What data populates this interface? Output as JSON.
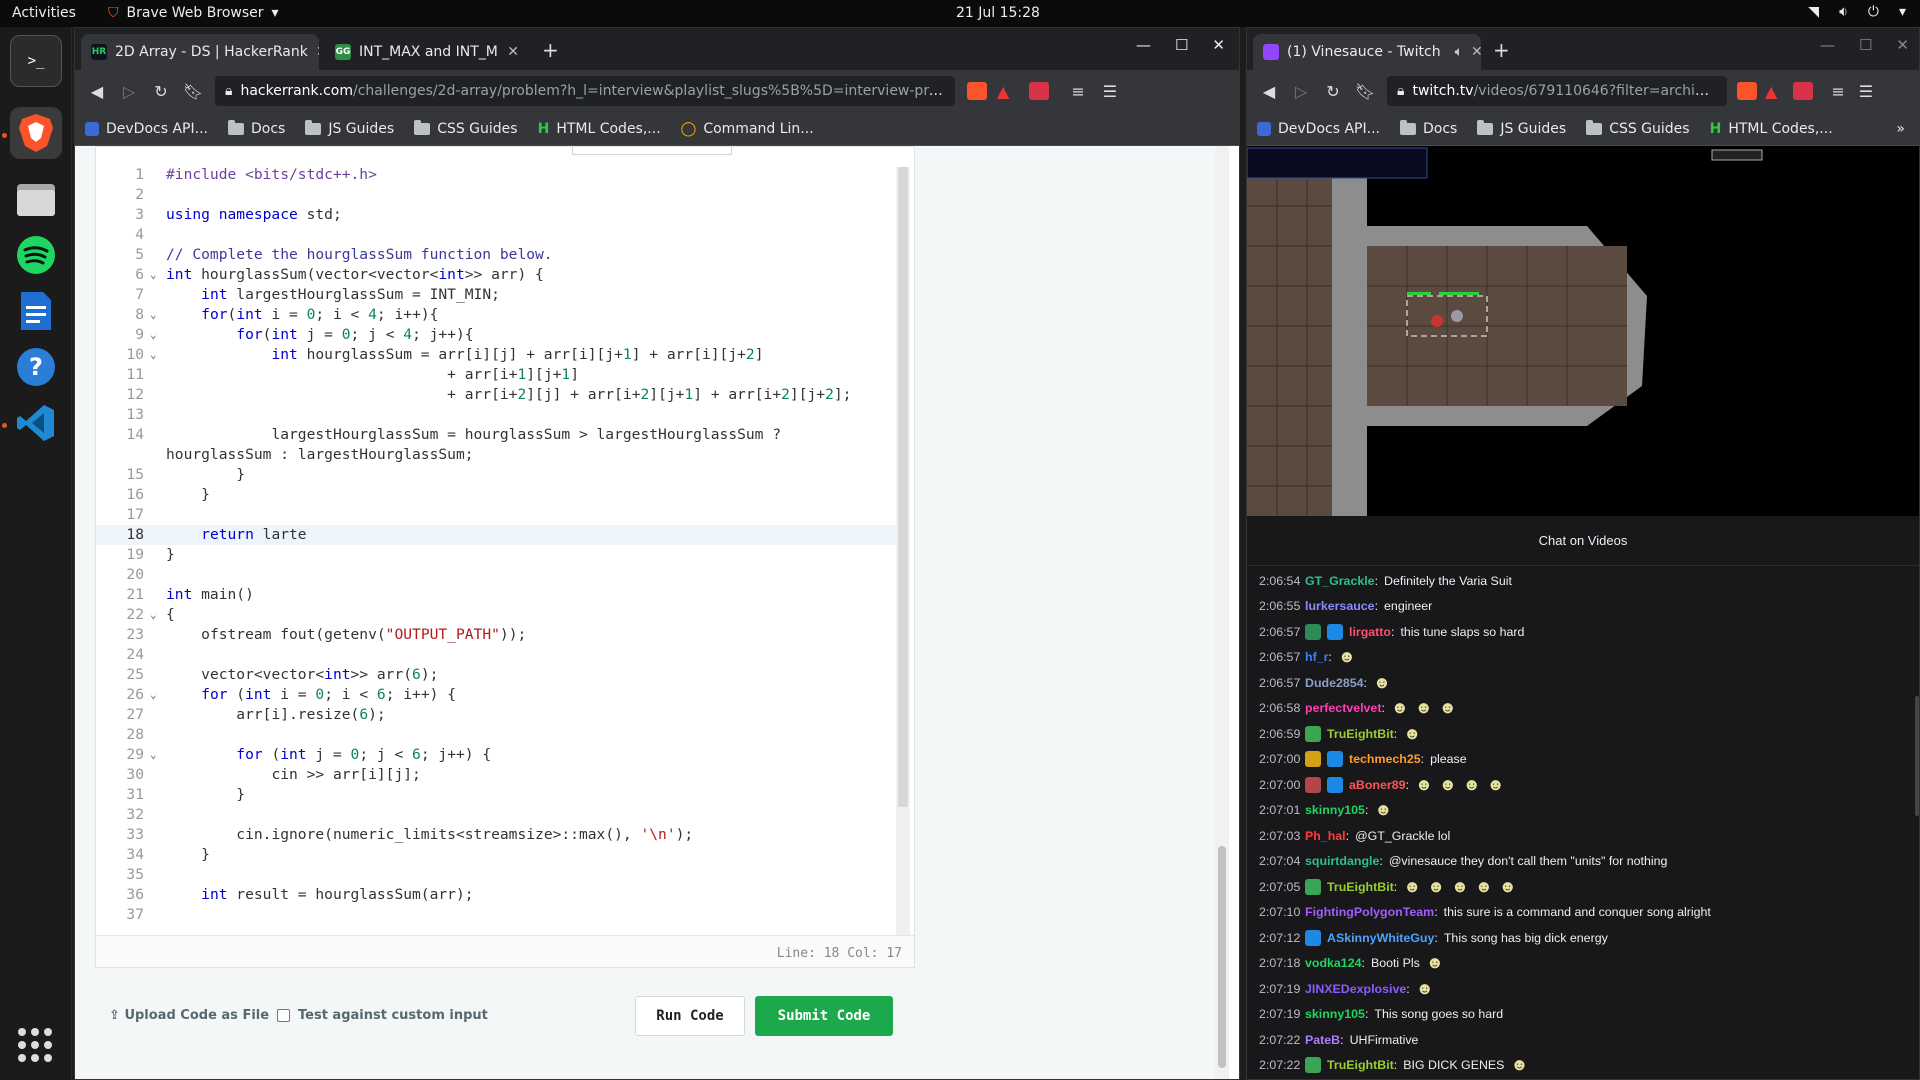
{
  "topbar": {
    "activities": "Activities",
    "app": "Brave Web Browser",
    "clock": "21 Jul  15:28"
  },
  "dock": {
    "items": [
      "terminal-icon",
      "brave-icon",
      "files-icon",
      "spotify-icon",
      "writer-icon",
      "help-icon",
      "vscode-icon"
    ],
    "show_apps": "apps-grid-icon"
  },
  "left": {
    "tabs": [
      {
        "label": "2D Array - DS | HackerRank",
        "favicon": "HR"
      },
      {
        "label": "INT_MAX and INT_MIN in C",
        "favicon": "GG"
      }
    ],
    "url_domain": "hackerrank.com",
    "url_path": "/challenges/2d-array/problem?h_l=interview&playlist_slugs%5B%5D=interview-preparation-kit&playlist_sl...",
    "bookmarks": [
      "DevDocs API...",
      "Docs",
      "JS Guides",
      "CSS Guides",
      "HTML Codes,...",
      "Command Lin..."
    ],
    "editor": {
      "status": "Line: 18 Col: 17",
      "lines": [
        {
          "n": "1",
          "html": "<span class='pp'>#include &lt;bits/stdc++.h&gt;</span>"
        },
        {
          "n": "2",
          "html": ""
        },
        {
          "n": "3",
          "html": "<span class='kw'>using namespace</span> std;"
        },
        {
          "n": "4",
          "html": ""
        },
        {
          "n": "5",
          "html": "<span class='cm'>// Complete the hourglassSum function below.</span>"
        },
        {
          "n": "6",
          "fold": true,
          "html": "<span class='kw'>int</span> hourglassSum(vector&lt;vector&lt;<span class='kw'>int</span>&gt;&gt; arr) {"
        },
        {
          "n": "7",
          "html": "    <span class='kw'>int</span> largestHourglassSum = INT_MIN;"
        },
        {
          "n": "8",
          "fold": true,
          "html": "    <span class='kw'>for</span>(<span class='kw'>int</span> i = <span class='num'>0</span>; i &lt; <span class='num'>4</span>; i++){"
        },
        {
          "n": "9",
          "fold": true,
          "html": "        <span class='kw'>for</span>(<span class='kw'>int</span> j = <span class='num'>0</span>; j &lt; <span class='num'>4</span>; j++){"
        },
        {
          "n": "10",
          "fold": true,
          "html": "            <span class='kw'>int</span> hourglassSum = arr[i][j] + arr[i][j+<span class='num'>1</span>] + arr[i][j+<span class='num'>2</span>]"
        },
        {
          "n": "11",
          "html": "                                + arr[i+<span class='num'>1</span>][j+<span class='num'>1</span>]"
        },
        {
          "n": "12",
          "html": "                                + arr[i+<span class='num'>2</span>][j] + arr[i+<span class='num'>2</span>][j+<span class='num'>1</span>] + arr[i+<span class='num'>2</span>][j+<span class='num'>2</span>];"
        },
        {
          "n": "13",
          "html": ""
        },
        {
          "n": "14",
          "wrap": true,
          "html": "            largestHourglassSum = hourglassSum &gt; largestHourglassSum ?\nhourglassSum : largestHourglassSum;"
        },
        {
          "n": "15",
          "html": "        }"
        },
        {
          "n": "16",
          "html": "    }"
        },
        {
          "n": "17",
          "html": ""
        },
        {
          "n": "18",
          "cur": true,
          "html": "    <span class='kw'>return</span> larte"
        },
        {
          "n": "19",
          "html": "}"
        },
        {
          "n": "20",
          "html": ""
        },
        {
          "n": "21",
          "html": "<span class='kw'>int</span> main()"
        },
        {
          "n": "22",
          "fold": true,
          "html": "{"
        },
        {
          "n": "23",
          "html": "    ofstream fout(getenv(<span class='str'>\"OUTPUT_PATH\"</span>));"
        },
        {
          "n": "24",
          "html": ""
        },
        {
          "n": "25",
          "html": "    vector&lt;vector&lt;<span class='kw'>int</span>&gt;&gt; arr(<span class='num'>6</span>);"
        },
        {
          "n": "26",
          "fold": true,
          "html": "    <span class='kw'>for</span> (<span class='kw'>int</span> i = <span class='num'>0</span>; i &lt; <span class='num'>6</span>; i++) {"
        },
        {
          "n": "27",
          "html": "        arr[i].resize(<span class='num'>6</span>);"
        },
        {
          "n": "28",
          "html": ""
        },
        {
          "n": "29",
          "fold": true,
          "html": "        <span class='kw'>for</span> (<span class='kw'>int</span> j = <span class='num'>0</span>; j &lt; <span class='num'>6</span>; j++) {"
        },
        {
          "n": "30",
          "html": "            cin &gt;&gt; arr[i][j];"
        },
        {
          "n": "31",
          "html": "        }"
        },
        {
          "n": "32",
          "html": ""
        },
        {
          "n": "33",
          "html": "        cin.ignore(numeric_limits&lt;streamsize&gt;::max(), <span class='str'>'\\n'</span>);"
        },
        {
          "n": "34",
          "html": "    }"
        },
        {
          "n": "35",
          "html": ""
        },
        {
          "n": "36",
          "html": "    <span class='kw'>int</span> result = hourglassSum(arr);"
        },
        {
          "n": "37",
          "html": ""
        }
      ]
    },
    "actions": {
      "upload": "Upload Code as File",
      "custom": "Test against custom input",
      "run": "Run Code",
      "submit": "Submit Code"
    }
  },
  "right": {
    "tab": {
      "label": "(1) Vinesauce - Twitch"
    },
    "url_domain": "twitch.tv",
    "url_path": "/videos/679110646?filter=archives...",
    "bookmarks": [
      "DevDocs API...",
      "Docs",
      "JS Guides",
      "CSS Guides",
      "HTML Codes,..."
    ],
    "chat_title": "Chat on Videos",
    "messages": [
      {
        "ts": "2:06:54",
        "user": "GT_Grackle",
        "color": "#2ebf8f",
        "text": "Definitely the Varia Suit"
      },
      {
        "ts": "2:06:55",
        "user": "lurkersauce",
        "color": "#8a8aff",
        "text": "engineer"
      },
      {
        "ts": "2:06:57",
        "user": "lirgatto",
        "color": "#ff4f6e",
        "badges": [
          "#2e8b57",
          "#1e88e5"
        ],
        "text": "this tune slaps so hard"
      },
      {
        "ts": "2:06:57",
        "user": "hf_r",
        "color": "#3d7fff",
        "emotes": 1
      },
      {
        "ts": "2:06:57",
        "user": "Dude2854",
        "color": "#8aa0c0",
        "emotes": 1
      },
      {
        "ts": "2:06:58",
        "user": "perfectvelvet",
        "color": "#ff3fb0",
        "emotes": 3
      },
      {
        "ts": "2:06:59",
        "user": "TruEightBit",
        "color": "#9acd32",
        "badges": [
          "#3aa655"
        ],
        "emotes": 1
      },
      {
        "ts": "2:07:00",
        "user": "techmech25",
        "color": "#ff9a2e",
        "badges": [
          "#d4a017",
          "#1e88e5"
        ],
        "text": "please"
      },
      {
        "ts": "2:07:00",
        "user": "aBoner89",
        "color": "#ff5555",
        "badges": [
          "#b34747",
          "#1e88e5"
        ],
        "emotes": 4
      },
      {
        "ts": "2:07:01",
        "user": "skinny105",
        "color": "#1fd65f",
        "emotes": 1
      },
      {
        "ts": "2:07:03",
        "user": "Ph_hal",
        "color": "#ff3b3b",
        "text": "@GT_Grackle lol"
      },
      {
        "ts": "2:07:04",
        "user": "squirtdangle",
        "color": "#2ebf8f",
        "text": "@vinesauce they don't call them \"units\" for nothing"
      },
      {
        "ts": "2:07:05",
        "user": "TruEightBit",
        "color": "#9acd32",
        "badges": [
          "#3aa655"
        ],
        "emotes": 5
      },
      {
        "ts": "2:07:10",
        "user": "FightingPolygonTeam",
        "color": "#a35cff",
        "text": "this sure is a command and conquer song alright"
      },
      {
        "ts": "2:07:12",
        "user": "ASkinnyWhiteGuy",
        "color": "#4aa3ff",
        "badges": [
          "#1e88e5"
        ],
        "text": "This song has big dick energy"
      },
      {
        "ts": "2:07:18",
        "user": "vodka124",
        "color": "#1fd65f",
        "text": "Booti Pls",
        "emotes": 1
      },
      {
        "ts": "2:07:19",
        "user": "JINXEDexplosive",
        "color": "#8a5cff",
        "emotes": 1
      },
      {
        "ts": "2:07:19",
        "user": "skinny105",
        "color": "#1fd65f",
        "text": "This song goes so hard"
      },
      {
        "ts": "2:07:22",
        "user": "PateB",
        "color": "#b07cff",
        "text": "UHFirmative"
      },
      {
        "ts": "2:07:22",
        "user": "TruEightBit",
        "color": "#9acd32",
        "badges": [
          "#3aa655"
        ],
        "text": "BIG DICK GENES",
        "emotes": 1
      }
    ]
  }
}
